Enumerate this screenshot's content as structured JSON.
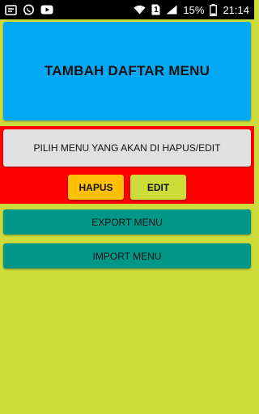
{
  "status_bar": {
    "left_icons": [
      "notification-icon",
      "whatsapp-icon",
      "youtube-icon"
    ],
    "right_icons": [
      "wifi-icon",
      "sim-1-icon",
      "signal-icon",
      "battery-icon"
    ],
    "sim_label": "1",
    "battery_percent": "15%",
    "time": "21:14"
  },
  "main": {
    "add_menu_label": "TAMBAH DAFTAR MENU",
    "select_menu_label": "PILIH MENU YANG AKAN DI HAPUS/EDIT",
    "delete_label": "HAPUS",
    "edit_label": "EDIT",
    "export_label": "EXPORT MENU",
    "import_label": "IMPORT MENU"
  },
  "colors": {
    "background": "#cddc39",
    "add_panel": "#03a9f4",
    "red_section": "#ff0000",
    "select_button": "#e0e0e0",
    "delete_button": "#ffc107",
    "edit_button": "#cddc39",
    "teal_buttons": "#009688"
  }
}
